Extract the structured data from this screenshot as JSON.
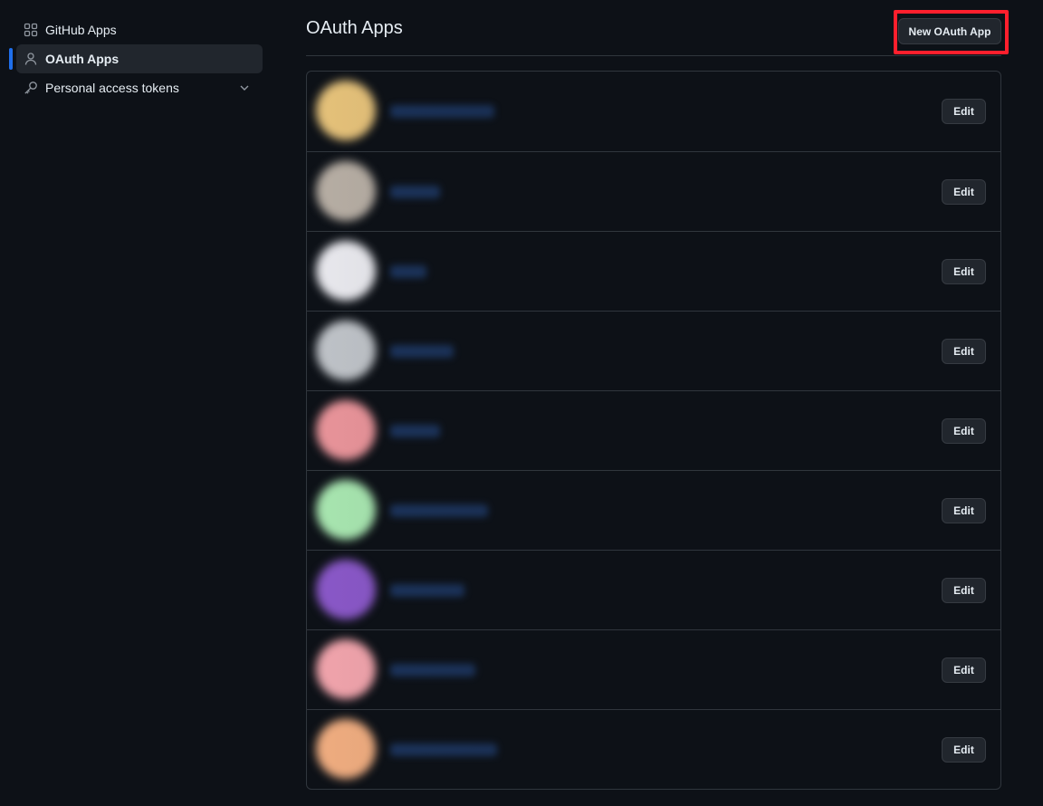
{
  "sidebar": {
    "items": [
      {
        "label": "GitHub Apps",
        "icon": "apps-grid-icon",
        "active": false
      },
      {
        "label": "OAuth Apps",
        "icon": "person-icon",
        "active": true
      },
      {
        "label": "Personal access tokens",
        "icon": "key-icon",
        "active": false,
        "expandable": true
      }
    ]
  },
  "header": {
    "title": "OAuth Apps",
    "new_button_label": "New OAuth App"
  },
  "apps": [
    {
      "avatar_color": "#e6c27a",
      "edit_label": "Edit"
    },
    {
      "avatar_color": "#b7aea4",
      "edit_label": "Edit"
    },
    {
      "avatar_color": "#e9e9ee",
      "edit_label": "Edit"
    },
    {
      "avatar_color": "#bfc3c8",
      "edit_label": "Edit"
    },
    {
      "avatar_color": "#e9949a",
      "edit_label": "Edit"
    },
    {
      "avatar_color": "#a8e6b0",
      "edit_label": "Edit"
    },
    {
      "avatar_color": "#8a58c8",
      "edit_label": "Edit"
    },
    {
      "avatar_color": "#f1a4ac",
      "edit_label": "Edit"
    },
    {
      "avatar_color": "#f0ad80",
      "edit_label": "Edit"
    }
  ],
  "colors": {
    "accent": "#1f6feb",
    "highlight_box": "#ff1f2d"
  }
}
